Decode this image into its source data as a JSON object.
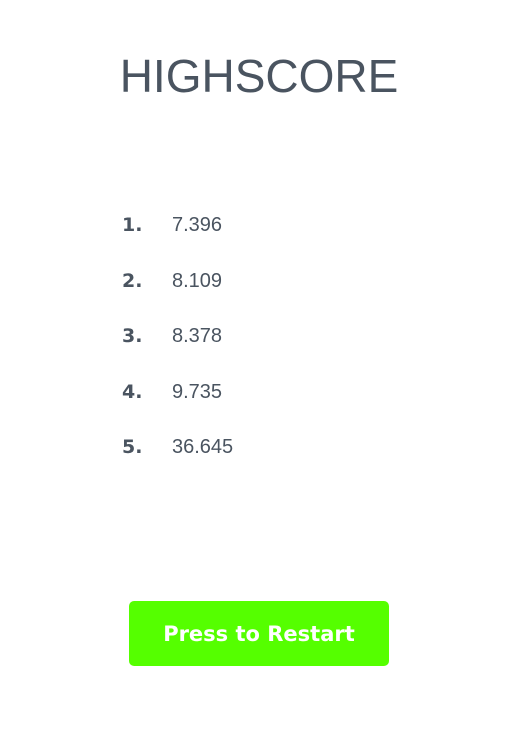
{
  "header": {
    "title": "HIGHSCORE"
  },
  "scores": [
    {
      "rank": "1.",
      "value": "7.396"
    },
    {
      "rank": "2.",
      "value": "8.109"
    },
    {
      "rank": "3.",
      "value": "8.378"
    },
    {
      "rank": "4.",
      "value": "9.735"
    },
    {
      "rank": "5.",
      "value": "36.645"
    }
  ],
  "actions": {
    "restart_label": "Press to Restart"
  },
  "colors": {
    "text": "#4a5460",
    "button_bg": "#55ff00",
    "button_text": "#ffffff"
  }
}
